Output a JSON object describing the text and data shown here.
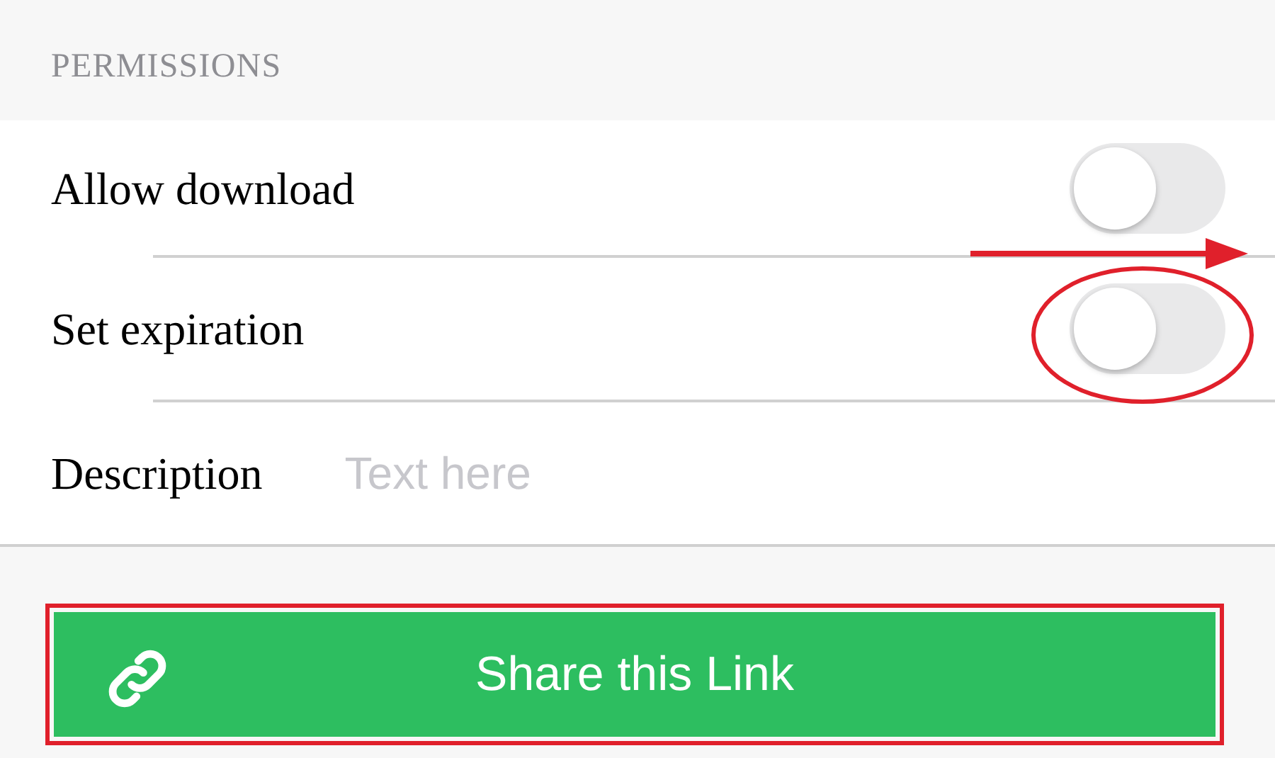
{
  "section_header": "PERMISSIONS",
  "rows": [
    {
      "kind": "toggle",
      "label": "Allow download",
      "on": false
    },
    {
      "kind": "toggle",
      "label": "Set expiration",
      "on": false
    },
    {
      "kind": "field",
      "label": "Description",
      "placeholder": "Text here"
    }
  ],
  "share_button": {
    "label": "Share this Link"
  }
}
